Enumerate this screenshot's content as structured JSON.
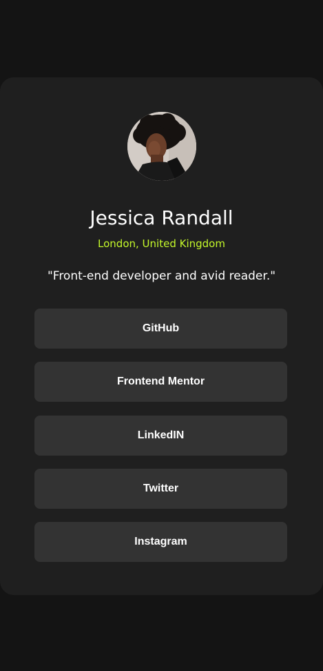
{
  "profile": {
    "name": "Jessica Randall",
    "location": "London, United Kingdom",
    "bio": "\"Front-end developer and avid reader.\""
  },
  "links": [
    {
      "label": "GitHub"
    },
    {
      "label": "Frontend Mentor"
    },
    {
      "label": "LinkedIN"
    },
    {
      "label": "Twitter"
    },
    {
      "label": "Instagram"
    }
  ],
  "colors": {
    "page_background": "#141414",
    "card_background": "#1f1f1f",
    "button_background": "#333333",
    "accent": "#c4f82a",
    "text": "#ffffff"
  },
  "icons": {
    "avatar": "profile-photo"
  }
}
